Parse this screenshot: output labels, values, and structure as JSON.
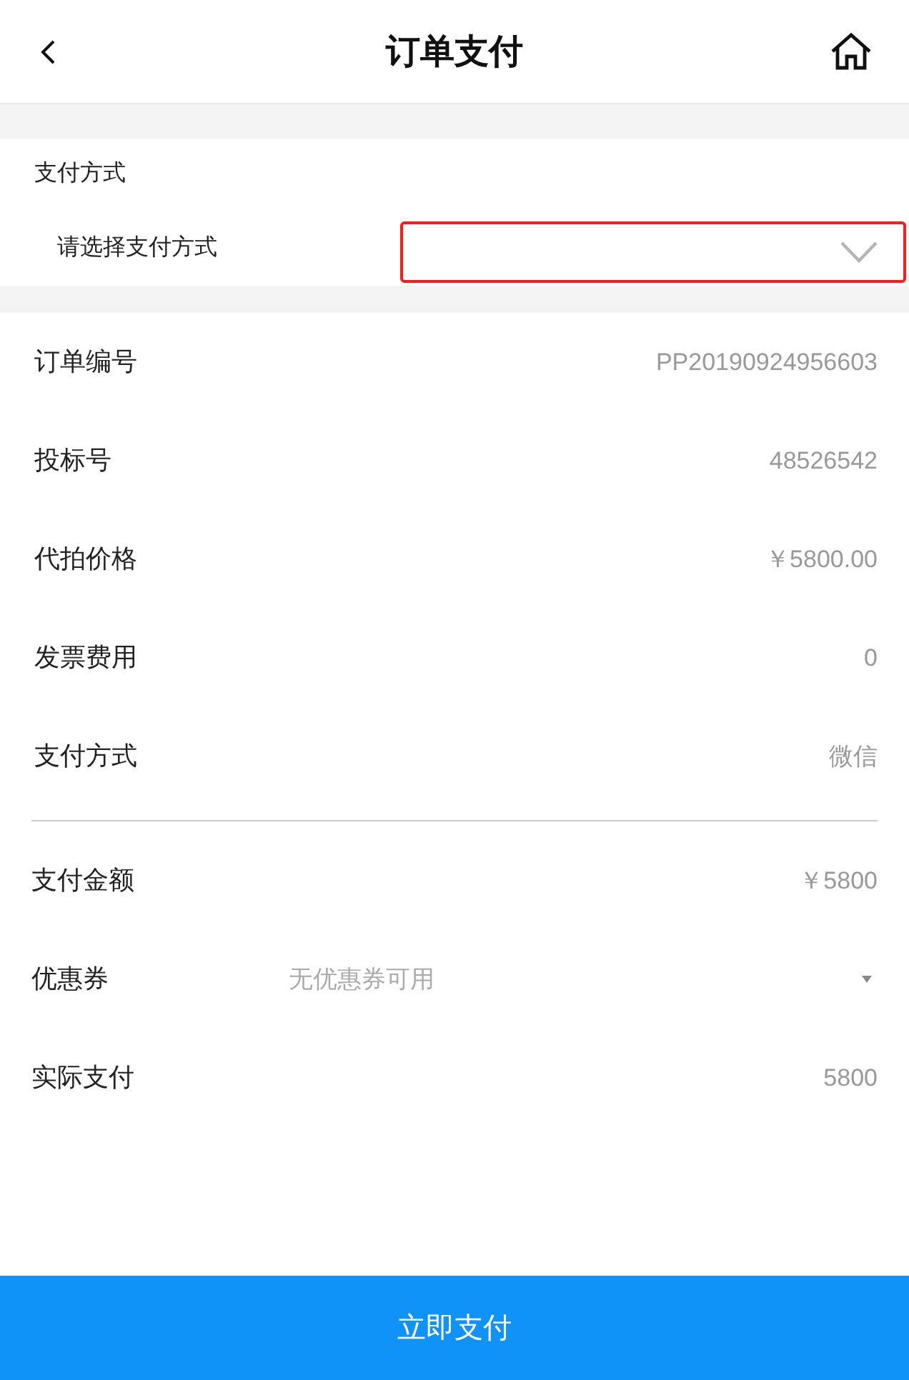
{
  "header": {
    "title": "订单支付"
  },
  "payment_method": {
    "heading": "支付方式",
    "prompt": "请选择支付方式",
    "select": {
      "highlighted": true
    }
  },
  "details": [
    {
      "label": "订单编号",
      "value": "PP20190924956603"
    },
    {
      "label": "投标号",
      "value": "48526542"
    },
    {
      "label": "代拍价格",
      "value": "￥5800.00"
    },
    {
      "label": "发票费用",
      "value": "0"
    },
    {
      "label": "支付方式",
      "value": "微信"
    }
  ],
  "summary": [
    {
      "kind": "text",
      "label": "支付金额",
      "value": "￥5800"
    },
    {
      "kind": "select",
      "label": "优惠券",
      "value": "无优惠券可用"
    },
    {
      "kind": "text",
      "label": "实际支付",
      "value": "5800"
    }
  ],
  "button": {
    "label": "立即支付"
  }
}
